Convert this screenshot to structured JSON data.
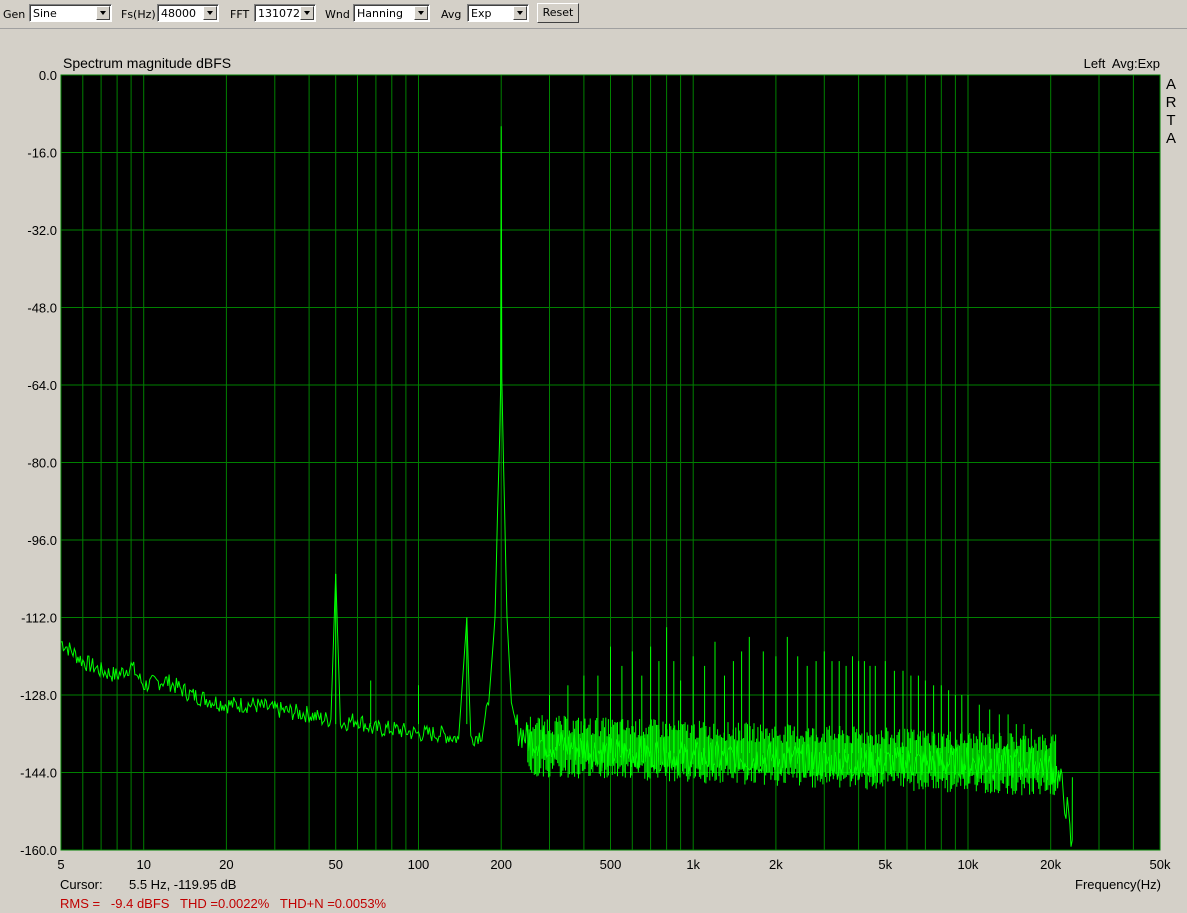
{
  "toolbar": {
    "gen_label": "Gen",
    "gen_value": "Sine",
    "fs_label": "Fs(Hz)",
    "fs_value": "48000",
    "fft_label": "FFT",
    "fft_value": "131072",
    "wnd_label": "Wnd",
    "wnd_value": "Hanning",
    "avg_label": "Avg",
    "avg_value": "Exp",
    "reset_label": "Reset"
  },
  "plot": {
    "title": "Spectrum magnitude dBFS",
    "status": "Left  Avg:Exp",
    "logo": [
      "A",
      "R",
      "T",
      "A"
    ],
    "cursor_label": "Cursor:",
    "cursor_value": "5.5 Hz, -119.95 dB",
    "xaxis_label": "Frequency(Hz)",
    "measurements": "RMS =   -9.4 dBFS   THD =0.0022%   THD+N =0.0053%"
  },
  "colors": {
    "plot_bg": "#000000",
    "grid": "#008000",
    "trace": "#00ff00",
    "window_bg": "#d4d0c8",
    "measure_text": "#c00000"
  },
  "chart_data": {
    "type": "line",
    "title": "Spectrum magnitude dBFS",
    "xlabel": "Frequency(Hz)",
    "ylabel": "",
    "xscale": "log",
    "xlim": [
      5,
      50000
    ],
    "ylim": [
      -160,
      0
    ],
    "grid": true,
    "yticks": [
      "0.0",
      "-16.0",
      "-32.0",
      "-48.0",
      "-64.0",
      "-80.0",
      "-96.0",
      "-112.0",
      "-128.0",
      "-144.0",
      "-160.0"
    ],
    "xticks": [
      {
        "v": 5,
        "label": "5"
      },
      {
        "v": 10,
        "label": "10"
      },
      {
        "v": 20,
        "label": "20"
      },
      {
        "v": 50,
        "label": "50"
      },
      {
        "v": 100,
        "label": "100"
      },
      {
        "v": 200,
        "label": "200"
      },
      {
        "v": 500,
        "label": "500"
      },
      {
        "v": 1000,
        "label": "1k"
      },
      {
        "v": 2000,
        "label": "2k"
      },
      {
        "v": 5000,
        "label": "5k"
      },
      {
        "v": 10000,
        "label": "10k"
      },
      {
        "v": 20000,
        "label": "20k"
      },
      {
        "v": 50000,
        "label": "50k"
      }
    ],
    "series": [
      {
        "points": [
          [
            5,
            -117
          ],
          [
            6,
            -121
          ],
          [
            7,
            -123
          ],
          [
            8,
            -124
          ],
          [
            9,
            -122
          ],
          [
            10,
            -126
          ],
          [
            12,
            -125
          ],
          [
            15,
            -128
          ],
          [
            20,
            -130
          ],
          [
            25,
            -130
          ],
          [
            30,
            -131
          ],
          [
            40,
            -132
          ],
          [
            45,
            -133
          ],
          [
            48,
            -133
          ],
          [
            50,
            -103
          ],
          [
            52,
            -134
          ],
          [
            60,
            -133
          ],
          [
            68,
            -135
          ],
          [
            80,
            -135
          ],
          [
            100,
            -136
          ],
          [
            120,
            -136
          ],
          [
            140,
            -137
          ],
          [
            150,
            -112
          ],
          [
            155,
            -137
          ],
          [
            170,
            -136
          ],
          [
            180,
            -130
          ],
          [
            190,
            -112
          ],
          [
            196,
            -80
          ],
          [
            199,
            -65
          ],
          [
            200,
            -10.6
          ],
          [
            201,
            -65
          ],
          [
            204,
            -80
          ],
          [
            210,
            -112
          ],
          [
            220,
            -134
          ],
          [
            250,
            -137
          ],
          [
            300,
            -138
          ],
          [
            400,
            -139
          ],
          [
            500,
            -140
          ],
          [
            700,
            -140
          ],
          [
            1000,
            -141
          ],
          [
            2000,
            -141
          ],
          [
            3000,
            -142
          ],
          [
            5000,
            -142
          ],
          [
            7000,
            -142
          ],
          [
            10000,
            -142
          ],
          [
            15000,
            -142
          ],
          [
            18000,
            -142
          ],
          [
            20000,
            -143
          ],
          [
            21000,
            -144
          ],
          [
            22000,
            -147
          ],
          [
            23000,
            -152
          ],
          [
            23500,
            -157
          ],
          [
            23950,
            -160
          ],
          [
            24000,
            -145
          ]
        ]
      }
    ],
    "spikes": [
      [
        50,
        -103
      ],
      [
        67,
        -125
      ],
      [
        100,
        -126
      ],
      [
        150,
        -112
      ],
      [
        300,
        -128
      ],
      [
        350,
        -126
      ],
      [
        400,
        -124
      ],
      [
        450,
        -124
      ],
      [
        500,
        -118
      ],
      [
        550,
        -122
      ],
      [
        600,
        -119
      ],
      [
        650,
        -124
      ],
      [
        700,
        -118
      ],
      [
        750,
        -121
      ],
      [
        800,
        -114
      ],
      [
        850,
        -121
      ],
      [
        900,
        -125
      ],
      [
        1000,
        -120
      ],
      [
        1100,
        -122
      ],
      [
        1200,
        -117
      ],
      [
        1300,
        -124
      ],
      [
        1400,
        -121
      ],
      [
        1500,
        -119
      ],
      [
        1600,
        -116
      ],
      [
        1800,
        -119
      ],
      [
        2000,
        -120
      ],
      [
        2200,
        -116
      ],
      [
        2400,
        -120
      ],
      [
        2600,
        -122
      ],
      [
        2800,
        -121
      ],
      [
        3000,
        -119
      ],
      [
        3200,
        -121
      ],
      [
        3400,
        -121
      ],
      [
        3600,
        -122
      ],
      [
        3800,
        -120
      ],
      [
        4000,
        -121
      ],
      [
        4200,
        -121
      ],
      [
        4400,
        -122
      ],
      [
        4600,
        -122
      ],
      [
        5000,
        -121
      ],
      [
        5400,
        -123
      ],
      [
        5800,
        -123
      ],
      [
        6200,
        -124
      ],
      [
        6600,
        -124
      ],
      [
        7000,
        -125
      ],
      [
        7500,
        -126
      ],
      [
        8000,
        -126
      ],
      [
        8500,
        -127
      ],
      [
        9000,
        -128
      ],
      [
        9500,
        -128
      ],
      [
        10000,
        -128
      ],
      [
        11000,
        -130
      ],
      [
        12000,
        -131
      ],
      [
        13000,
        -132
      ],
      [
        14000,
        -132
      ],
      [
        15000,
        -134
      ],
      [
        16000,
        -134
      ],
      [
        17000,
        -135
      ]
    ]
  }
}
